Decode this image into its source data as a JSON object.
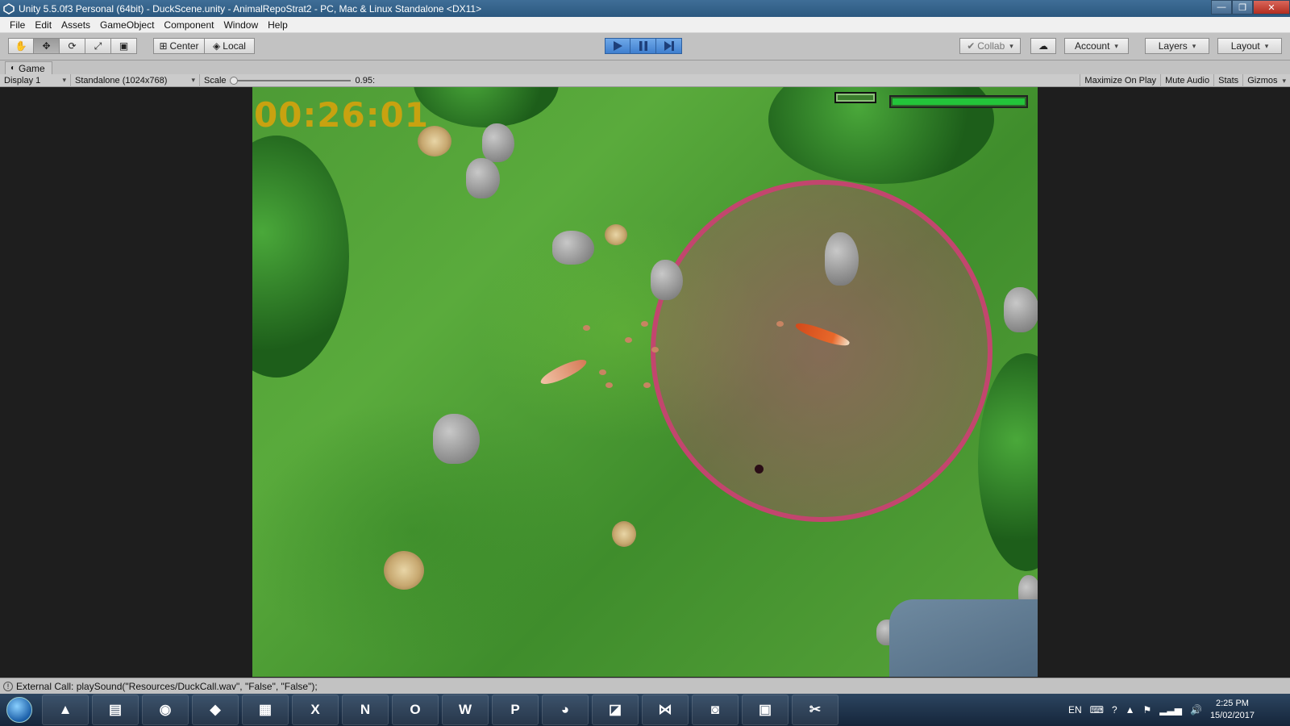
{
  "window": {
    "title": "Unity 5.5.0f3 Personal (64bit) - DuckScene.unity - AnimalRepoStrat2 - PC, Mac & Linux Standalone <DX11>",
    "minimize": "—",
    "restore": "❐",
    "close": "✕"
  },
  "menu": [
    "File",
    "Edit",
    "Assets",
    "GameObject",
    "Component",
    "Window",
    "Help"
  ],
  "toolbar": {
    "center_label": "Center",
    "local_label": "Local",
    "collab_label": "Collab",
    "account_label": "Account",
    "layers_label": "Layers",
    "layout_label": "Layout"
  },
  "game_tab": {
    "label": "Game",
    "display": "Display 1",
    "resolution": "Standalone (1024x768)",
    "scale_label": "Scale",
    "scale_value": "0.95:",
    "maximize_on_play": "Maximize On Play",
    "mute_audio": "Mute Audio",
    "stats": "Stats",
    "gizmos": "Gizmos"
  },
  "game": {
    "timer": "00:26:01",
    "health_fraction": 1.0
  },
  "status": {
    "message": "External Call: playSound(\"Resources/DuckCall.wav\", \"False\", \"False\");"
  },
  "taskbar": {
    "apps": [
      "vlc-icon",
      "file-explorer-icon",
      "chrome-icon",
      "unity-icon",
      "calculator-icon",
      "excel-icon",
      "onenote-icon",
      "outlook-icon",
      "word-icon",
      "powerpoint-icon",
      "github-desktop-icon",
      "unknown-app-icon",
      "visual-studio-icon",
      "discord-icon",
      "photo-viewer-icon",
      "snipping-tool-icon"
    ],
    "app_glyphs": [
      "▲",
      "▤",
      "◉",
      "◆",
      "▦",
      "X",
      "N",
      "O",
      "W",
      "P",
      "◕",
      "◪",
      "⋈",
      "◙",
      "▣",
      "✂"
    ],
    "language": "EN",
    "time": "2:25 PM",
    "date": "15/02/2017"
  }
}
